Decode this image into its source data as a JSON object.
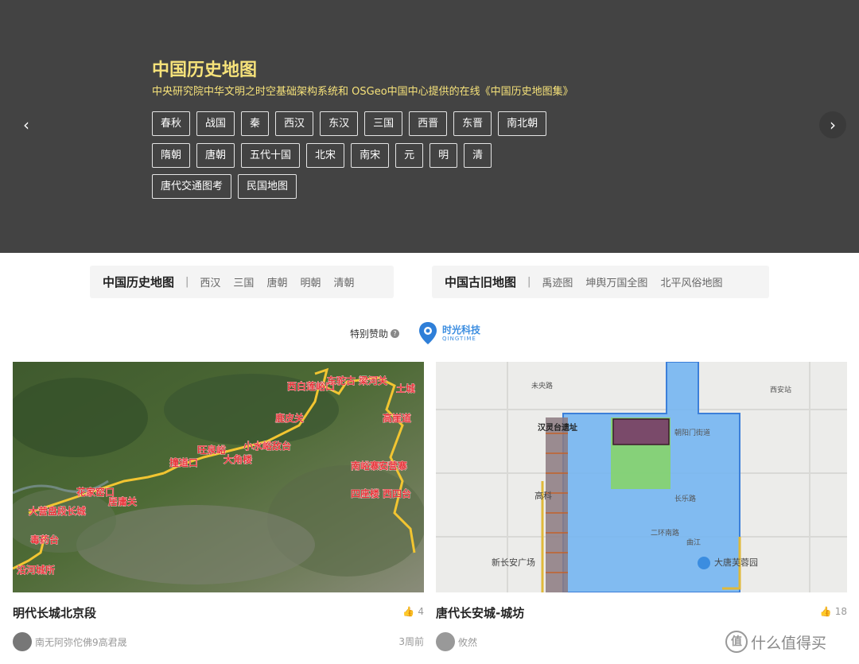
{
  "hero": {
    "title": "中国历史地图",
    "subtitle": "中央研究院中华文明之时空基础架构系统和 OSGeo中国中心提供的在线《中国历史地图集》",
    "eras_row1": [
      "春秋",
      "战国",
      "秦",
      "西汉",
      "东汉",
      "三国",
      "西晋",
      "东晋",
      "南北朝"
    ],
    "eras_row2": [
      "隋朝",
      "唐朝",
      "五代十国",
      "北宋",
      "南宋",
      "元",
      "明",
      "清"
    ],
    "eras_row3": [
      "唐代交通图考",
      "民国地图"
    ],
    "prev": "‹",
    "next": "›"
  },
  "categories": {
    "left": {
      "title": "中国历史地图",
      "sep": "|",
      "links": [
        "西汉",
        "三国",
        "唐朝",
        "明朝",
        "清朝"
      ]
    },
    "right": {
      "title": "中国古旧地图",
      "sep": "|",
      "links": [
        "禹迹图",
        "坤舆万国全图",
        "北平风俗地图"
      ]
    }
  },
  "sponsor": {
    "label": "特别赞助",
    "help": "?",
    "logo_name": "时光科技",
    "logo_sub": "QINGTIME"
  },
  "cards": [
    {
      "title": "明代长城北京段",
      "likes": "4",
      "author": "南无阿弥佗佛9高君晟",
      "time": "3周前",
      "map_labels": [
        "西白莲峪口",
        "东驼古",
        "梁河关",
        "土城",
        "鹿皮关",
        "高崖道",
        "小水峪敌台",
        "旺泉峪",
        "大角楼",
        "撞道口",
        "南峪寨口",
        "安营寨",
        "四座楼",
        "西四台",
        "花家窑口",
        "居庸关",
        "大营盘段长城",
        "毒药台",
        "沿河城所"
      ]
    },
    {
      "title": "唐代长安城-城坊",
      "likes": "18",
      "author": "攸然",
      "time": "",
      "map_labels": [
        "汉灵台遗址",
        "高科",
        "新长安广场",
        "大唐芙蓉园",
        "未央路",
        "西安站",
        "朝阳门街道",
        "长乐路",
        "二环南路",
        "曲江"
      ]
    }
  ],
  "watermark": {
    "icon": "值",
    "text": "什么值得买"
  }
}
